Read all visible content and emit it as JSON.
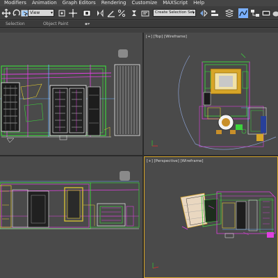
{
  "menu": {
    "items": [
      "Modifiers",
      "Animation",
      "Graph Editors",
      "Rendering",
      "Customize",
      "MAXScript",
      "Help"
    ]
  },
  "toolbar": {
    "view_dropdown": "View",
    "selection_set": "Create Selection Set",
    "icons": [
      "move-icon",
      "rotate-icon",
      "select-icon",
      "scale-icon",
      "render-icon",
      "teapot-icon"
    ]
  },
  "ribbon": {
    "tabs": [
      "Selection",
      "Object Paint"
    ]
  },
  "viewports": {
    "top_label": "[+] [Top] [Wireframe]",
    "perspective_label": "[+] [Perspective] [Wireframe]"
  },
  "colors": {
    "viewport_bg": "#4a4a4a",
    "active_border": "#d8a628",
    "wire_green": "#3cd23c",
    "wire_magenta": "#e040e0",
    "wire_white": "#f0f0f0",
    "wire_yellow": "#e8d030"
  }
}
